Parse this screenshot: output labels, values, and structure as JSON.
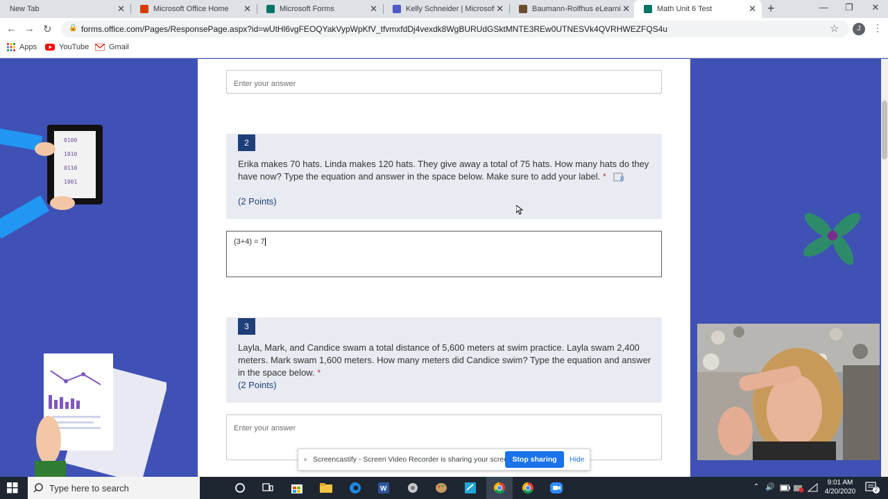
{
  "browser": {
    "tabs": [
      {
        "label": "New Tab",
        "icon": "none"
      },
      {
        "label": "Microsoft Office Home",
        "icon": "office-icon"
      },
      {
        "label": "Microsoft Forms",
        "icon": "forms-icon"
      },
      {
        "label": "Kelly Schneider | Microsoft T",
        "icon": "teams-icon"
      },
      {
        "label": "Baumann-Rolfhus eLearning",
        "icon": "page-icon"
      },
      {
        "label": "Math Unit 6 Test",
        "icon": "forms-icon"
      }
    ],
    "active_tab": 5,
    "url": "forms.office.com/Pages/ResponsePage.aspx?id=wUtHl6vgFEOQYakVypWpKfV_tfvmxfdDj4vexdk8WgBURUdGSktMNTE3REw0UTNESVk4QVRHWEZFQS4u",
    "profile_initial": "J",
    "bookmarks": [
      {
        "label": "Apps",
        "icon": "apps-grid-icon"
      },
      {
        "label": "YouTube",
        "icon": "youtube-icon"
      },
      {
        "label": "Gmail",
        "icon": "gmail-icon"
      }
    ]
  },
  "form": {
    "prev_answer_placeholder": "Enter your answer",
    "questions": [
      {
        "number": "2",
        "text": "Erika makes 70 hats.  Linda makes 120 hats.  They give away a total of 75 hats.  How many hats do they have now?  Type the equation and answer in the space below.  Make sure to add your label.",
        "required_mark": "*",
        "points": "(2 Points)",
        "answer": "(3+4) = 7"
      },
      {
        "number": "3",
        "text": "Layla, Mark, and Candice swam a total distance of 5,600 meters at swim practice.  Layla swam 2,400 meters.  Mark swam 1,600 meters.  How many meters did Candice swim?  Type the equation and answer in the space below.",
        "required_mark": "*",
        "points": "(2 Points)",
        "answer_placeholder": "Enter your answer"
      }
    ]
  },
  "screencastify": {
    "message": "Screencastify - Screen Video Recorder is sharing your screen.",
    "stop_label": "Stop sharing",
    "hide_label": "Hide"
  },
  "taskbar": {
    "search_placeholder": "Type here to search",
    "time": "9:01 AM",
    "date": "4/20/2020",
    "notification_count": "2"
  },
  "colors": {
    "page_background": "#3f51b5",
    "question_badge": "#1f3f7a",
    "question_card": "#e9ebf2",
    "required": "#c4314b",
    "stop_button": "#1a73e8",
    "taskbar": "#1e2632"
  }
}
